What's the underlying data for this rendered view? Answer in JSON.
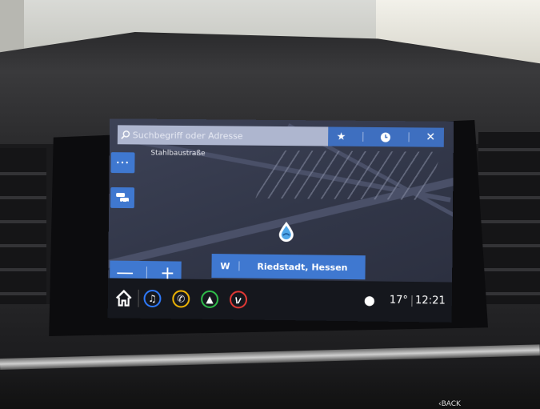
{
  "search": {
    "placeholder": "Suchbegriff oder Adresse",
    "favorites_icon": "star-icon",
    "history_icon": "clock-icon",
    "close_icon": "close-icon"
  },
  "map": {
    "street_label": "Stahlbaustraße"
  },
  "side_buttons": {
    "more_label": "•••",
    "traffic_icon": "traffic-cars-icon"
  },
  "zoom": {
    "out_label": "—",
    "in_label": "+"
  },
  "destination": {
    "direction": "W",
    "place": "Riedstadt, Hessen"
  },
  "bottom_bar": {
    "home_icon": "home-icon",
    "apps": [
      {
        "name": "audio",
        "icon": "music-note-icon",
        "color": "#2f7bff"
      },
      {
        "name": "phone",
        "icon": "phone-icon",
        "color": "#f2b705"
      },
      {
        "name": "navigation",
        "icon": "navigation-arrow-icon",
        "color": "#2fbf4a"
      },
      {
        "name": "seat",
        "icon": "seat-icon",
        "color": "#e53935"
      }
    ]
  },
  "status": {
    "temperature": "17°",
    "time": "12:21"
  },
  "vehicle": {
    "back_button": "‹BACK"
  },
  "colors": {
    "accent": "#3f78d0",
    "map_background": "#353a4d",
    "bar_background": "#15171d"
  }
}
